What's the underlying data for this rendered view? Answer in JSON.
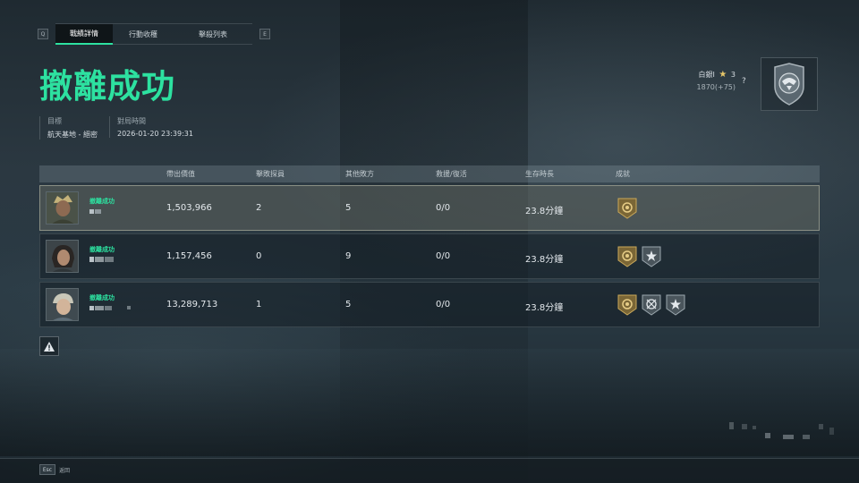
{
  "nav": {
    "left_key": "Q",
    "right_key": "E",
    "tabs": [
      {
        "label": "戰績詳情",
        "active": true
      },
      {
        "label": "行動收穫",
        "active": false
      },
      {
        "label": "擊殺列表",
        "active": false
      }
    ]
  },
  "result_title": "撤離成功",
  "info": {
    "target_label": "目標",
    "target_value": "航天基地 - 絕密",
    "time_label": "對局時間",
    "time_value": "2026-01-20 23:39:31"
  },
  "rank": {
    "name": "白銀I",
    "stars": "3",
    "points": "1870(+75)",
    "help": "?"
  },
  "table": {
    "headers": [
      "帶出價值",
      "擊敗探員",
      "其他敗方",
      "救援/復活",
      "生存時長",
      "成就"
    ],
    "rows": [
      {
        "status": "撤離成功",
        "value": "1,503,966",
        "kills": "2",
        "others": "5",
        "rescue": "0/0",
        "time": "23.8分鐘",
        "achievements": [
          "gold-medal-icon"
        ],
        "selected": true
      },
      {
        "status": "撤離成功",
        "value": "1,157,456",
        "kills": "0",
        "others": "9",
        "rescue": "0/0",
        "time": "23.8分鐘",
        "achievements": [
          "gold-medal-icon",
          "silver-star-icon"
        ],
        "selected": false
      },
      {
        "status": "撤離成功",
        "value": "13,289,713",
        "kills": "1",
        "others": "5",
        "rescue": "0/0",
        "time": "23.8分鐘",
        "achievements": [
          "gold-medal-icon",
          "silver-compass-icon",
          "silver-star-icon"
        ],
        "selected": false
      }
    ]
  },
  "footer": {
    "esc_key": "Esc",
    "esc_label": "返回"
  },
  "colors": {
    "accent": "#2de1a0",
    "header_bg": "#4a565d",
    "gold": "#c9a85a"
  }
}
